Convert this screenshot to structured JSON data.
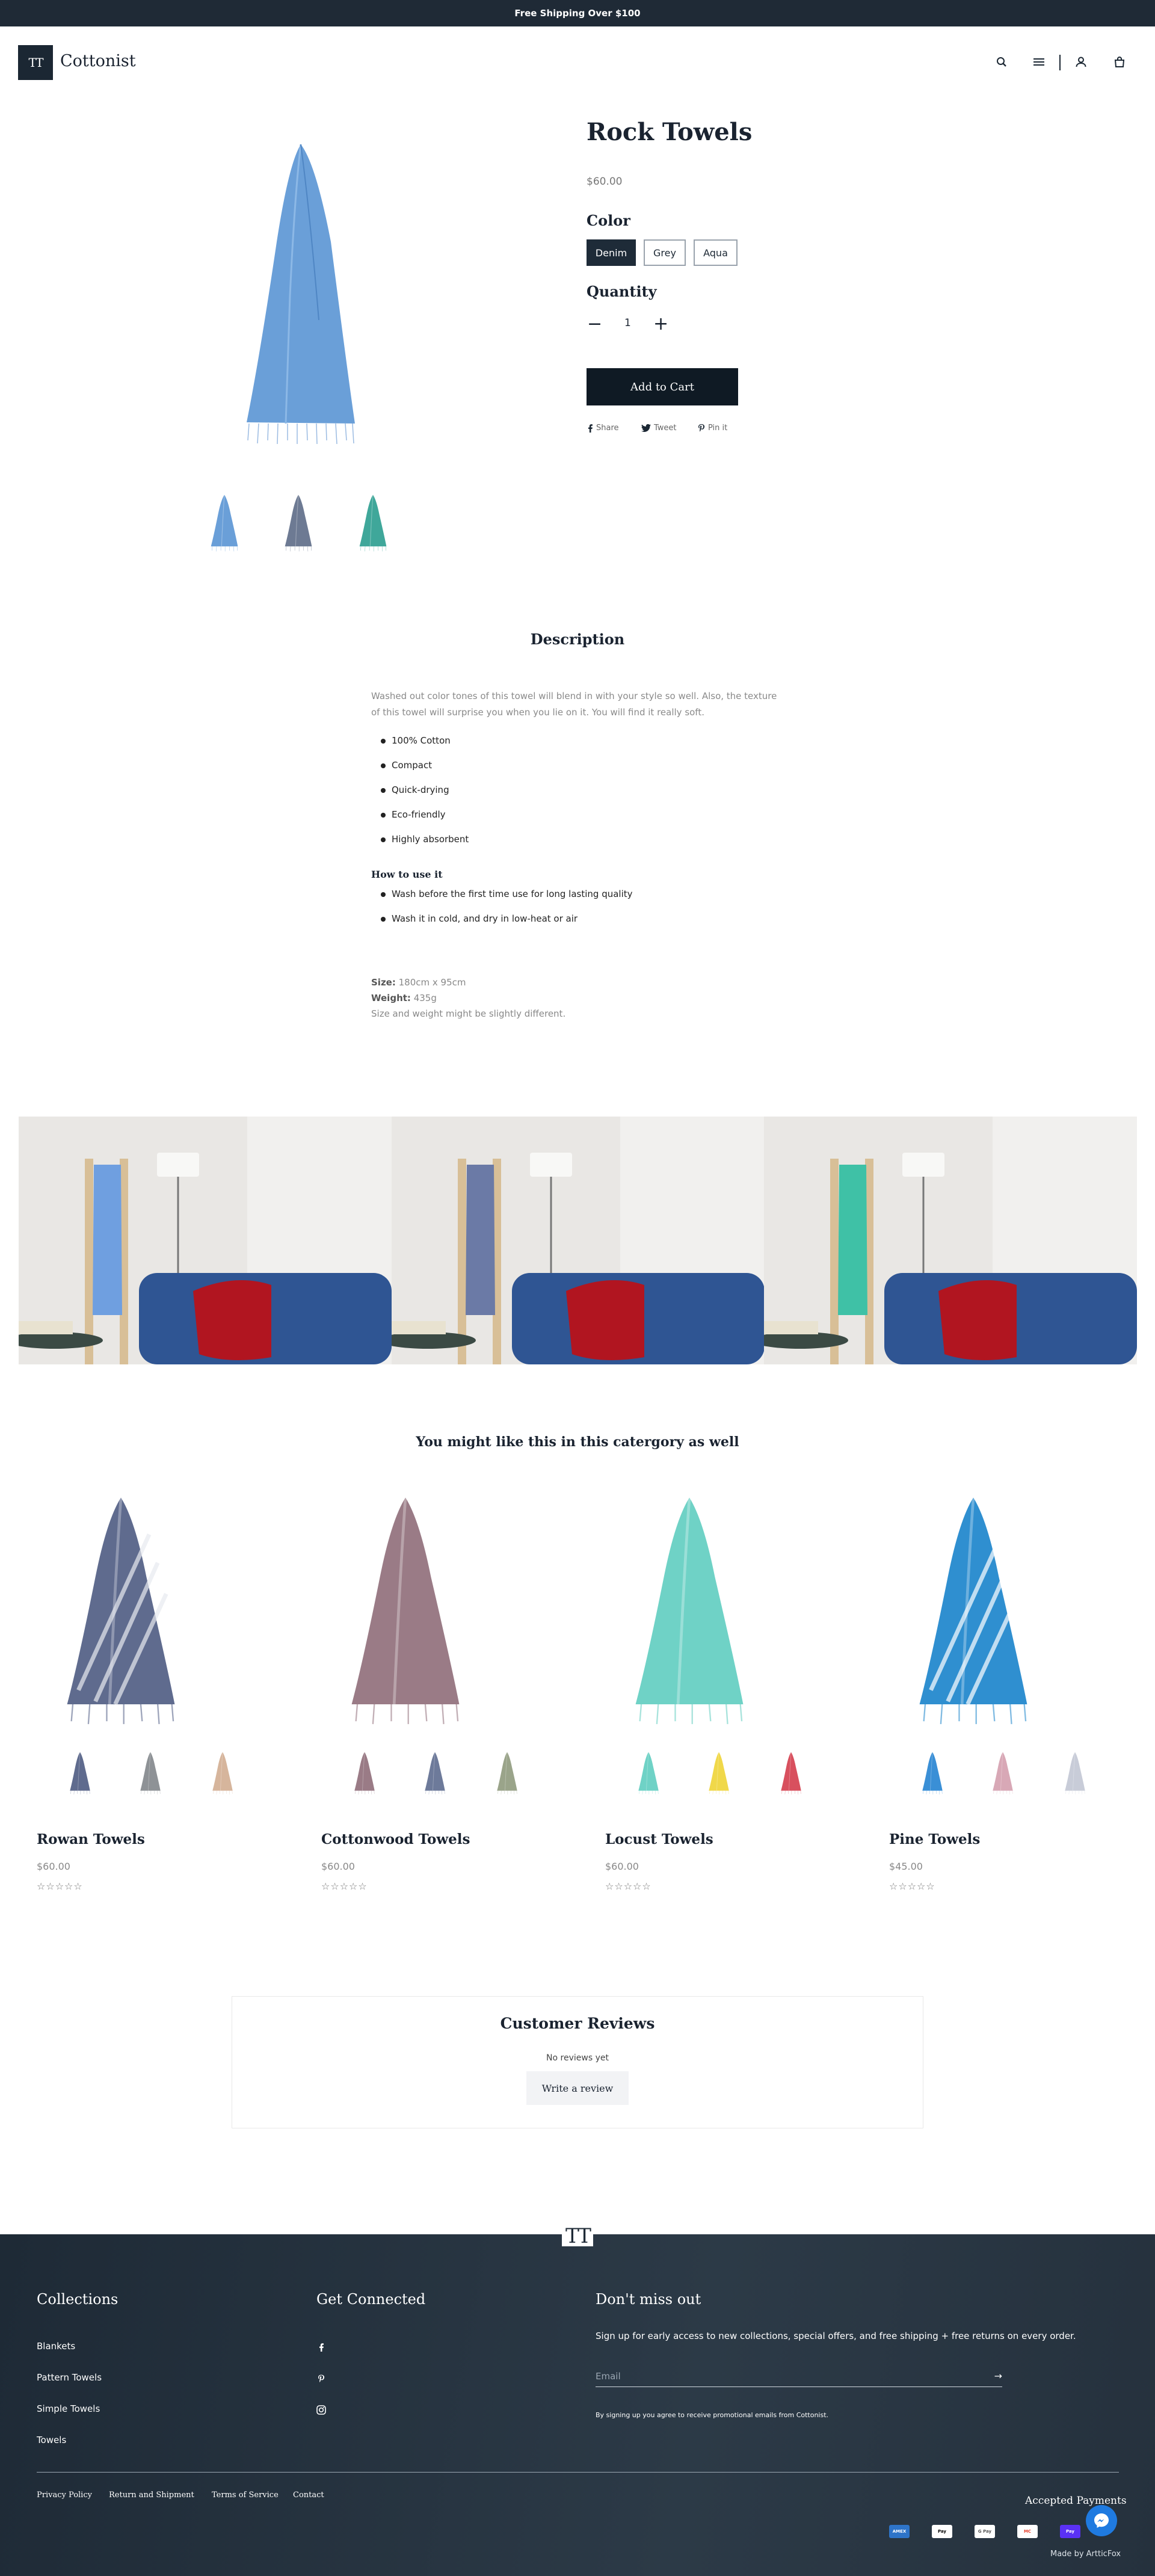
{
  "announcement": "Free Shipping Over $100",
  "header": {
    "logo_mark": "TT",
    "brand": "Cottonist",
    "icons": [
      "search-icon",
      "menu-icon",
      "user-icon",
      "bag-icon"
    ]
  },
  "product": {
    "title": "Rock Towels",
    "price": "$60.00",
    "color_label": "Color",
    "colors": [
      "Denim",
      "Grey",
      "Aqua"
    ],
    "selected_color": "Denim",
    "quantity_label": "Quantity",
    "quantity": "1",
    "add_to_cart": "Add to Cart",
    "share": [
      "Share",
      "Tweet",
      "Pin it"
    ],
    "thumb_colors": [
      "#6a9fd8",
      "#6d7a93",
      "#3fa79a"
    ]
  },
  "description": {
    "title": "Description",
    "text": "Washed out color tones of this towel will blend in with your style so well. Also, the texture of this towel will surprise you when you lie on it. You will find it really soft.",
    "features": [
      "100% Cotton",
      "Compact",
      "Quick-drying",
      "Eco-friendly",
      "Highly absorbent"
    ],
    "howto_title": "How to use it",
    "howto": [
      "Wash before the first time use for long lasting quality",
      "Wash it in cold, and dry in low-heat or air"
    ],
    "size_label": "Size:",
    "size": "180cm x 95cm",
    "weight_label": "Weight:",
    "weight": "435g",
    "note": "Size and weight might be slightly different."
  },
  "gallery_colors": [
    "#6f9fe0",
    "#6b7aa6",
    "#3fc1a6"
  ],
  "related": {
    "title": "You might like this in this catergory as well",
    "items": [
      {
        "name": "Rowan Towels",
        "price": "$60.00",
        "stars": "☆☆☆☆☆",
        "main": "#5f6b8e",
        "thumbs": [
          "#5f6b8e",
          "#8e9296",
          "#d6b59c"
        ]
      },
      {
        "name": "Cottonwood Towels",
        "price": "$60.00",
        "stars": "☆☆☆☆☆",
        "main": "#9a7b86",
        "thumbs": [
          "#9a7b86",
          "#6d7a9a",
          "#9aa48a"
        ]
      },
      {
        "name": "Locust Towels",
        "price": "$60.00",
        "stars": "☆☆☆☆☆",
        "main": "#6fd2c6",
        "thumbs": [
          "#6fd2c6",
          "#f0d84a",
          "#d8505e"
        ]
      },
      {
        "name": "Pine Towels",
        "price": "$45.00",
        "stars": "☆☆☆☆☆",
        "main": "#2f8fd0",
        "thumbs": [
          "#3a8fd6",
          "#d8a8b6",
          "#c8ccd8"
        ]
      }
    ]
  },
  "reviews": {
    "title": "Customer Reviews",
    "empty": "No reviews yet",
    "button": "Write a review"
  },
  "footer": {
    "logo_mark": "TT",
    "collections_title": "Collections",
    "collections": [
      "Blankets",
      "Pattern Towels",
      "Simple Towels",
      "Towels"
    ],
    "connected_title": "Get Connected",
    "social_icons": [
      "facebook-icon",
      "pinterest-icon",
      "instagram-icon"
    ],
    "newsletter_title": "Don't miss out",
    "newsletter_text": "Sign up for early access to new collections, special offers, and free shipping + free returns on every order.",
    "email_placeholder": "Email",
    "consent": "By signing up you agree to receive promotional emails from Cottonist.",
    "bottom_links": [
      "Privacy Policy",
      "Return and Shipment",
      "Terms of Service",
      "Contact"
    ],
    "accepted_title": "Accepted Payments",
    "payments": [
      "AMEX",
      "Pay",
      "G Pay",
      "MC",
      "Pay"
    ],
    "made_by": "Made by ArtticFox"
  }
}
